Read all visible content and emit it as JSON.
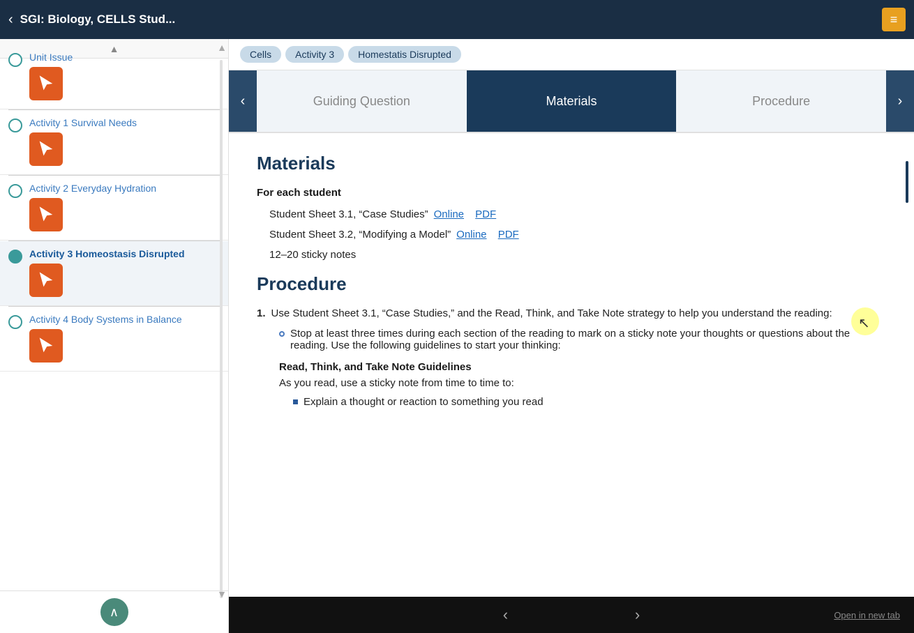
{
  "header": {
    "back_icon": "‹",
    "title": "SGI: Biology, CELLS Stud...",
    "menu_icon": "≡"
  },
  "sidebar": {
    "scroll_up_label": "▲",
    "items": [
      {
        "id": "unit-issue",
        "label": "Unit Issue",
        "active": false,
        "circle_active": false,
        "has_icon": true
      },
      {
        "id": "activity-1",
        "label": "Activity 1 Survival Needs",
        "active": false,
        "circle_active": false,
        "has_icon": true
      },
      {
        "id": "activity-2",
        "label": "Activity 2 Everyday Hydration",
        "active": false,
        "circle_active": false,
        "has_icon": true
      },
      {
        "id": "activity-3",
        "label": "Activity 3 Homeostasis Disrupted",
        "active": true,
        "circle_active": true,
        "has_icon": true
      },
      {
        "id": "activity-4",
        "label": "Activity 4 Body Systems in Balance",
        "active": false,
        "circle_active": false,
        "has_icon": true
      }
    ],
    "scroll_up_btn": "∧"
  },
  "breadcrumb": {
    "items": [
      "Cells",
      "Activity 3",
      "Homestatis Disrupted"
    ]
  },
  "section_nav": {
    "left_arrow": "‹",
    "items": [
      {
        "label": "Guiding Question",
        "active": false
      },
      {
        "label": "Materials",
        "active": true
      },
      {
        "label": "Procedure",
        "active": false
      }
    ],
    "right_arrow": "›"
  },
  "materials": {
    "title": "Materials",
    "subsection": "For each student",
    "items": [
      {
        "text": "Student Sheet 3.1, “Case Studies”",
        "link1_label": "Online",
        "link2_label": "PDF"
      },
      {
        "text": "Student Sheet 3.2, “Modifying a Model”",
        "link1_label": "Online",
        "link2_label": "PDF"
      }
    ],
    "sticky_notes": "12–20 sticky notes"
  },
  "procedure": {
    "title": "Procedure",
    "steps": [
      {
        "number": "1.",
        "text": "Use Student Sheet 3.1, “Case Studies,” and the Read, Think, and Take Note strategy to help you understand the reading:",
        "sub_bullets": [
          "Stop at least three times during each section of the reading to mark on a sticky note your thoughts or questions about the reading. Use the following guidelines to start your thinking:"
        ],
        "guideline_title": "Read, Think, and Take Note Guidelines",
        "guideline_intro": "As you read, use a sticky note from time to time to:",
        "final_bullets": [
          "Explain a thought or reaction to something you read"
        ]
      }
    ]
  },
  "bottom_nav": {
    "prev_icon": "‹",
    "next_icon": "›",
    "open_tab_label": "Open in new tab"
  }
}
